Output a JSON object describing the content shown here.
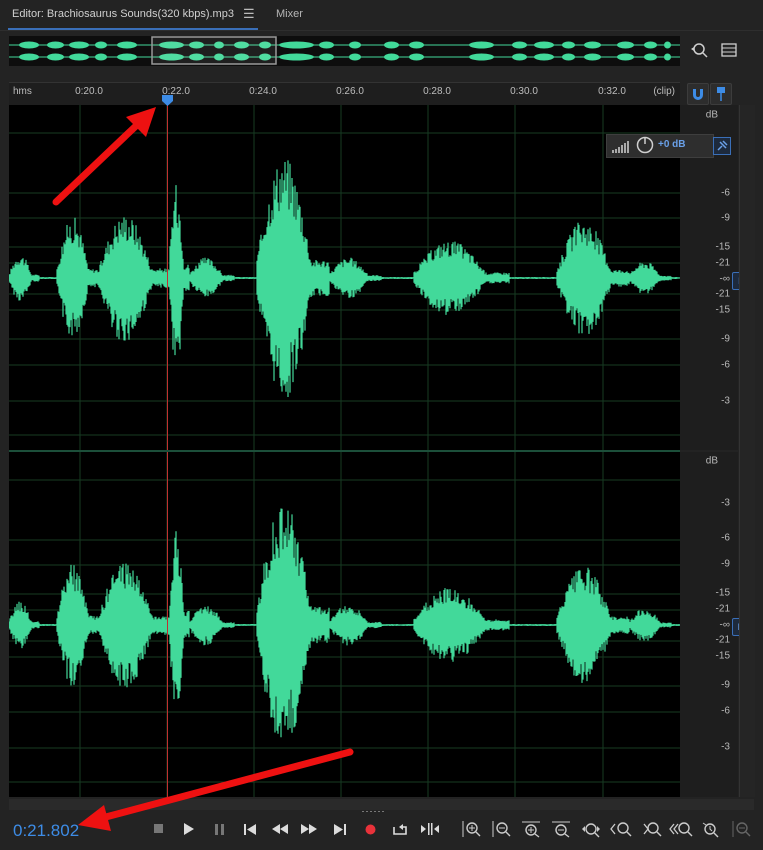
{
  "tabs": {
    "editor_label": "Editor: Brachiosaurus Sounds(320  kbps).mp3",
    "editor_menu_icon": "hamburger-icon",
    "mixer_label": "Mixer"
  },
  "ruler": {
    "unit_label": "hms",
    "end_label": "(clip)",
    "ticks": [
      "0:20.0",
      "0:22.0",
      "0:24.0",
      "0:26.0",
      "0:28.0",
      "0:30.0",
      "0:32.0"
    ]
  },
  "db_scale": {
    "header": "dB",
    "labels": [
      "-3",
      "-6",
      "-9",
      "-15",
      "-21",
      "-∞",
      "-21",
      "-15",
      "-9",
      "-6",
      "-3"
    ]
  },
  "channels": {
    "left_badge": "L",
    "right_badge": "R"
  },
  "hud": {
    "gain_label": "+0 dB"
  },
  "transport": {
    "current_time": "0:21.802"
  },
  "colors": {
    "waveform": "#42d99a",
    "playhead": "#c03030",
    "accent": "#3d8ce6",
    "annotation_arrow": "#ee1111"
  },
  "icons": {
    "overview_zoom": "zoom-to-fit-icon",
    "overview_list": "list-icon",
    "snap": "magnet-icon",
    "marker": "marker-pin-icon",
    "transport": [
      "stop-icon",
      "play-icon",
      "pause-icon",
      "go-to-start-icon",
      "rewind-icon",
      "fast-forward-icon",
      "go-to-end-icon",
      "record-icon",
      "loop-icon",
      "skip-selection-icon"
    ],
    "zoom": [
      "zoom-in-amplitude-icon",
      "zoom-out-amplitude-icon",
      "zoom-in-time-icon",
      "zoom-out-time-icon",
      "zoom-out-full-icon",
      "zoom-in-point-icon",
      "zoom-in-selection-icon",
      "zoom-in-left-edge-icon",
      "zoom-in-right-edge-icon",
      "zoom-reset-icon"
    ]
  }
}
